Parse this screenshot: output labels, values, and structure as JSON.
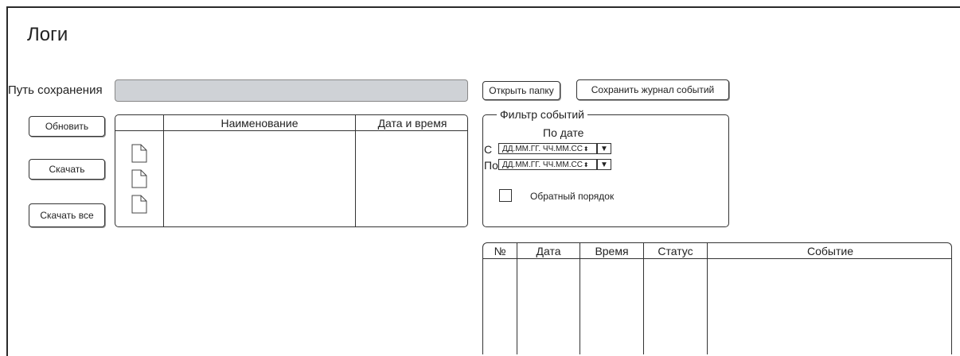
{
  "page": {
    "title": "Логи"
  },
  "save_path": {
    "label": "Путь сохранения",
    "value": ""
  },
  "buttons": {
    "open_folder": "Открыть папку",
    "save_log": "Сохранить журнал событий",
    "refresh": "Обновить",
    "download": "Скачать",
    "download_all": "Скачать все"
  },
  "files_table": {
    "columns": [
      "",
      "Наименование",
      "Дата и время"
    ],
    "rows": [
      {
        "icon": "file-icon",
        "name": "",
        "datetime": ""
      },
      {
        "icon": "file-icon",
        "name": "",
        "datetime": ""
      },
      {
        "icon": "file-icon",
        "name": "",
        "datetime": ""
      }
    ]
  },
  "filter": {
    "legend": "Фильтр событий",
    "by_date": "По дате",
    "from_label": "С",
    "to_label": "По",
    "from_value": "ДД.ММ.ГГ. ЧЧ.ММ.СС",
    "to_value": "ДД.ММ.ГГ. ЧЧ.ММ.СС",
    "reverse_order_label": "Обратный порядок",
    "reverse_order_checked": false
  },
  "events_table": {
    "columns": [
      "№",
      "Дата",
      "Время",
      "Статус",
      "Событие"
    ],
    "rows": []
  }
}
